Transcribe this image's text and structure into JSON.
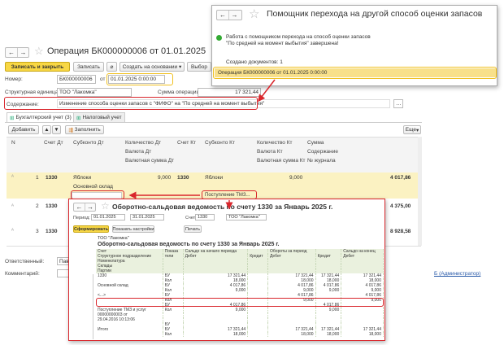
{
  "main": {
    "title": "Операция БК000000006 от 01.01.2025",
    "toolbar": {
      "save_close": "Записать и закрыть",
      "save": "Записать",
      "create_based": "Создать на основании",
      "select": "Выбор"
    },
    "number_label": "Номер:",
    "number_value": "БК000000006",
    "from_label": "от",
    "date_value": "01.01.2025  0:00:00",
    "org_label": "Структурная единица:",
    "org_value": "ТОО \"Лакомка\"",
    "sum_label": "Сумма операции:",
    "sum_value": "17 321,44",
    "content_label": "Содержание:",
    "content_value": "Изменение способа оценки запасов с \"ФИФО\" на \"По средней на момент выбытия\"",
    "tabs": [
      "Бухгалтерский учет (3)",
      "Налоговый учет"
    ],
    "add_label": "Добавить",
    "fill_label": "Заполнить",
    "more_label": "Еще",
    "columns": {
      "n": "N",
      "dt": "Счет Дт",
      "sub_dt": "Субконто Дт",
      "qty_dt": "Количество Дт",
      "cur_dt": "Валюта Дт",
      "cursum_dt": "Валютная сумма Дт",
      "kt": "Счет Кт",
      "sub_kt": "Субконто Кт",
      "qty_kt": "Количество Кт",
      "cur_kt": "Валюта Кт",
      "cursum_kt": "Валютная сумма Кт",
      "sum": "Сумма",
      "content": "Содержание",
      "journal": "№ журнала"
    },
    "rows": [
      {
        "n": "1",
        "dt": "1330",
        "sub1": "Яблоки",
        "sub2": "Основной склад",
        "qty": "9,000",
        "kt": "1330",
        "ksub1": "Яблоки",
        "ksub2": "Поступление ТМЗ...",
        "kqty": "9,000",
        "sum": "4 017,86"
      },
      {
        "n": "2",
        "dt": "1330",
        "sub1": "",
        "sub2": "",
        "qty": "",
        "kt": "",
        "ksub1": "",
        "ksub2": "",
        "kqty": "",
        "sum": "4 375,00"
      },
      {
        "n": "3",
        "dt": "1330",
        "sub1": "",
        "sub2": "",
        "qty": "",
        "kt": "",
        "ksub1": "",
        "ksub2": "",
        "kqty": "",
        "sum": "8 928,58"
      }
    ],
    "resp_label": "Ответственный:",
    "resp_value": "Павл",
    "comment_label": "Комментарий:",
    "admin": "Б (Администратор)"
  },
  "assistant": {
    "title": "Помощник перехода на другой способ оценки запасов",
    "message": "Работа с помощником перехода на способ оценки запасов \"По средней на момент выбытия\" завершена!",
    "created": "Создано документов: 1",
    "link": "Операция БК000000006 от 01.01.2025 0:00:00"
  },
  "report": {
    "title": "Оборотно-сальдовая ведомость по счету 1330  за Январь 2025 г.",
    "period_label": "Период:",
    "from": "01.01.2025",
    "to": "31.01.2025",
    "account_label": "Счет:",
    "account": "1330",
    "org_value": "ТОО \"Лакомка\"",
    "generate": "Сформировать",
    "settings": "Показать настройки",
    "print": "Печать",
    "org_text": "ТОО \"Лакомка\"",
    "heading": "Оборотно-сальдовая ведомость по счету 1330  за Январь 2025 г.",
    "head_rows": [
      [
        "Счет",
        "Показа",
        "Сальдо на начало периода",
        "",
        "Обороты за период",
        "",
        "Сальдо на конец"
      ],
      [
        "Структурное подразделение",
        "тели",
        "Дебет",
        "Кредит",
        "Дебет",
        "Кредит",
        "Дебет"
      ],
      [
        "Номенклатура",
        "",
        "",
        "",
        "",
        "",
        ""
      ],
      [
        "Склады",
        "",
        "",
        "",
        "",
        "",
        ""
      ],
      [
        "Партии",
        "",
        "",
        "",
        "",
        "",
        ""
      ]
    ],
    "body_rows": [
      [
        "1330",
        "БУ",
        "17 321,44",
        "",
        "17 321,44",
        "17 321,44",
        "17 321,44"
      ],
      [
        "",
        "Кол",
        "18,000",
        "",
        "18,000",
        "18,000",
        "18,000"
      ],
      [
        "   Основной склад",
        "БУ",
        "4 017,86",
        "",
        "4 017,86",
        "4 017,86",
        "4 017,86"
      ],
      [
        "",
        "Кол",
        "9,000",
        "",
        "9,000",
        "9,000",
        "9,000"
      ],
      [
        "     <...>",
        "БУ",
        "",
        "",
        "4 017,86",
        "",
        "4 017,86"
      ],
      [
        "",
        "Кол",
        "",
        "",
        "9,000",
        "",
        "9,000"
      ],
      [
        "",
        "БУ",
        "4 017,86",
        "",
        "",
        "4 017,86",
        ""
      ],
      [
        "     Поступление ТМЗ и услуг",
        "Кол",
        "9,000",
        "",
        "",
        "9,000",
        ""
      ],
      [
        "     00000000003 от",
        "",
        "",
        "",
        "",
        "",
        ""
      ],
      [
        "     29.04.2016 10:13:06",
        "",
        "",
        "",
        "",
        "",
        ""
      ],
      [
        "",
        "БУ",
        "",
        "",
        "",
        "",
        ""
      ],
      [
        "Итого",
        "БУ",
        "17 321,44",
        "",
        "17 321,44",
        "17 321,44",
        "17 321,44"
      ],
      [
        "",
        "Кол",
        "18,000",
        "",
        "18,000",
        "18,000",
        "18,000"
      ]
    ]
  }
}
